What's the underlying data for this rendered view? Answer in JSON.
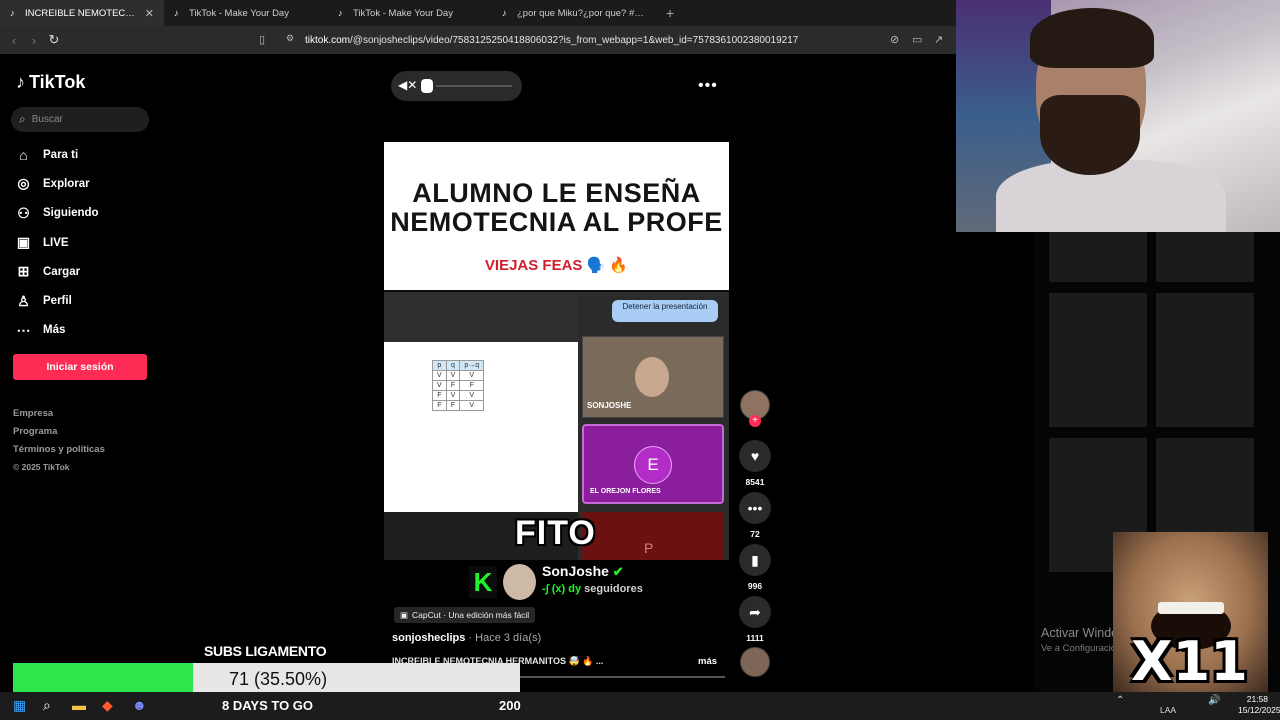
{
  "browser": {
    "tabs": [
      {
        "label": "INCREIBLE NEMOTECNIA HERMA",
        "active": true
      },
      {
        "label": "TikTok - Make Your Day",
        "active": false
      },
      {
        "label": "TikTok - Make Your Day",
        "active": false
      },
      {
        "label": "¿por que Miku?¿por que? #Chibido",
        "active": false
      }
    ],
    "url_host": "tiktok.com",
    "url_path": "/@sonjosheclips/video/7583125250418806032?is_from_webapp=1&web_id=7578361002380019217"
  },
  "sidebar": {
    "logo": "TikTok",
    "search_placeholder": "Buscar",
    "items": [
      {
        "label": "Para ti",
        "icon": "home-icon"
      },
      {
        "label": "Explorar",
        "icon": "compass-icon"
      },
      {
        "label": "Siguiendo",
        "icon": "following-icon"
      },
      {
        "label": "LIVE",
        "icon": "live-icon"
      },
      {
        "label": "Cargar",
        "icon": "upload-icon"
      },
      {
        "label": "Perfil",
        "icon": "profile-icon"
      },
      {
        "label": "Más",
        "icon": "more-icon"
      }
    ],
    "login_label": "Iniciar sesión",
    "footer": [
      "Empresa",
      "Programa",
      "Términos y políticas"
    ],
    "copyright": "© 2025 TikTok"
  },
  "video": {
    "title_line1": "ALUMNO LE ENSEÑA",
    "title_line2": "NEMOTECNIA AL PROFE",
    "subtitle": "VIEJAS FEAS 🗣️ 🔥",
    "stop_presentation": "Detener la presentación",
    "cam_label": "SONJOSHE",
    "participant_initial": "E",
    "participant_name": "EL OREJON FLORES",
    "participant2_initial": "P",
    "caption_word": "FITO",
    "truth_table": {
      "headers": [
        "p",
        "q",
        "p→q"
      ],
      "rows": [
        [
          "V",
          "V",
          "V"
        ],
        [
          "V",
          "F",
          "F"
        ],
        [
          "F",
          "V",
          "V"
        ],
        [
          "F",
          "F",
          "V"
        ]
      ]
    }
  },
  "brand": {
    "name": "SonJoshe",
    "sub_prefix": "-∫ (x) dy",
    "sub_suffix": "seguidores"
  },
  "post": {
    "capcut": "CapCut · Una edición más fácil",
    "author": "sonjosheclips",
    "time": " · Hace 3 día(s)",
    "caption": "INCREIBLE NEMOTECNIA HERMANITOS 🤯 🔥 ...",
    "more": "más"
  },
  "actions": {
    "likes": "8541",
    "comments": "72",
    "saves": "996",
    "shares": "1111"
  },
  "windows_watermark": {
    "line1": "Activar Windows",
    "line2": "Ve a Configuración"
  },
  "meme_text": "X11",
  "subs_goal": {
    "title": "SUBS LIGAMENTO",
    "progress_text": "71 (35.50%)",
    "progress_fraction": 0.355,
    "days_left": "8 DAYS TO GO",
    "goal": "200"
  },
  "taskbar": {
    "lang": "LAA",
    "time": "21:58",
    "date": "15/12/2025"
  },
  "colors": {
    "accent": "#fe2c55",
    "progress": "#2ee64a"
  }
}
